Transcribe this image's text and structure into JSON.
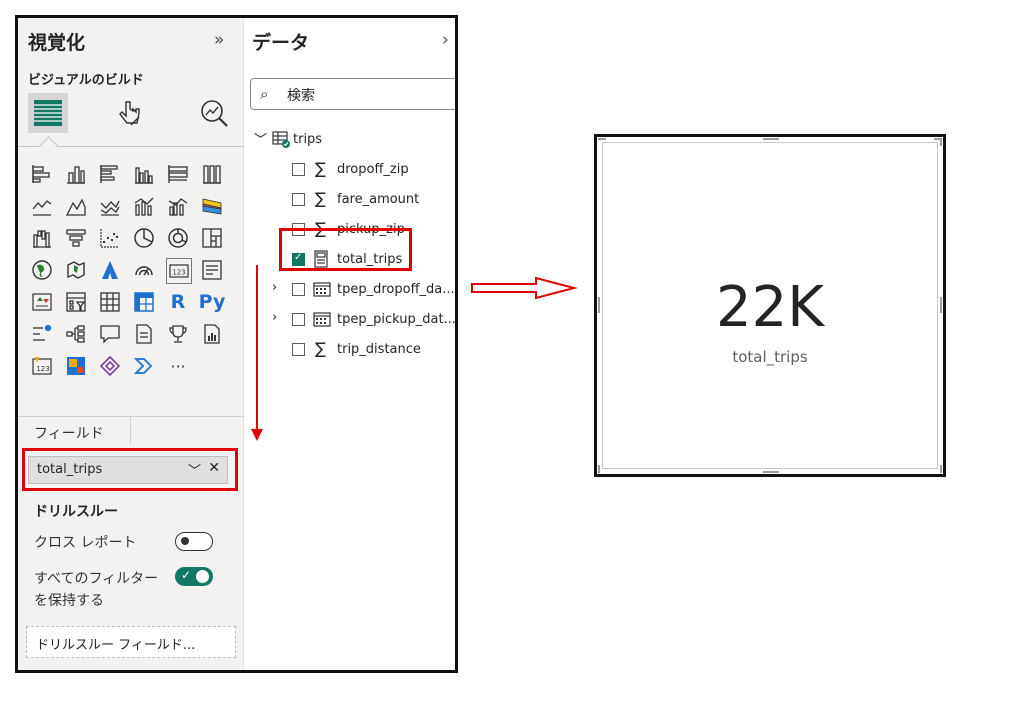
{
  "viz_pane": {
    "title": "視覚化",
    "collapse_glyph": "»",
    "build_label": "ビジュアルのビルド",
    "fields_label": "フィールド",
    "field_well": {
      "value": "total_trips"
    },
    "drillthrough": {
      "title": "ドリルスルー",
      "cross_report_label": "クロス レポート",
      "cross_report_on": false,
      "keep_filters_label_line1": "すべてのフィルター",
      "keep_filters_label_line2": "を保持する",
      "keep_filters_on": true,
      "drop_zone": "ドリルスルー フィールド..."
    },
    "more_visuals": "···",
    "r_visual": "R",
    "py_visual": "Py"
  },
  "data_pane": {
    "title": "データ",
    "collapse_glyph": "›",
    "search_placeholder": "検索",
    "table": "trips",
    "fields": [
      {
        "name": "dropoff_zip",
        "type": "sum",
        "checked": false
      },
      {
        "name": "fare_amount",
        "type": "sum",
        "checked": false
      },
      {
        "name": "pickup_zip",
        "type": "sum",
        "checked": false
      },
      {
        "name": "total_trips",
        "type": "measure",
        "checked": true
      },
      {
        "name": "tpep_dropoff_da...",
        "type": "date",
        "checked": false
      },
      {
        "name": "tpep_pickup_dat...",
        "type": "date",
        "checked": false
      },
      {
        "name": "trip_distance",
        "type": "sum",
        "checked": false
      }
    ],
    "more_glyph": "···"
  },
  "card": {
    "value": "22K",
    "label": "total_trips"
  },
  "colors": {
    "accent": "#117865",
    "highlight": "#e00000"
  }
}
